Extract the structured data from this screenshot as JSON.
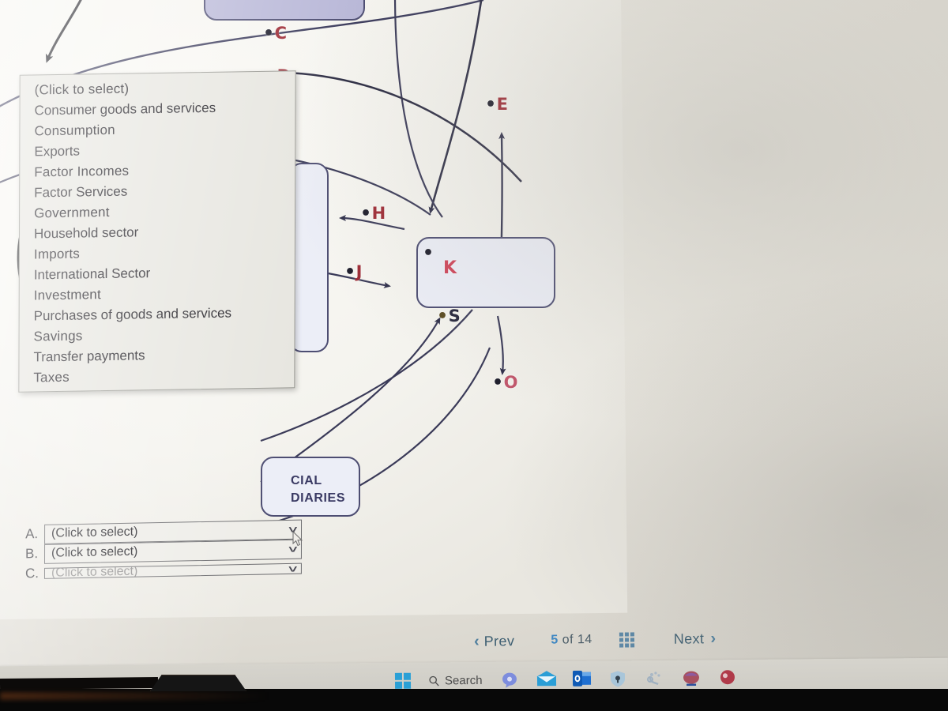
{
  "app": {
    "context": "economics circular-flow diagram worksheet shown on a monitor"
  },
  "dropdown": {
    "name": "open-select-list",
    "options": [
      "(Click to select)",
      "Consumer goods and services",
      "Consumption",
      "Exports",
      "Factor Incomes",
      "Factor Services",
      "Government",
      "Household sector",
      "Imports",
      "International Sector",
      "Investment",
      "Purchases of goods and services",
      "Savings",
      "Transfer payments",
      "Taxes"
    ]
  },
  "answer_rows": [
    {
      "letter": "A.",
      "value": "(Click to select)",
      "chevron": "chevron-down-icon"
    },
    {
      "letter": "B.",
      "value": "(Click to select)",
      "chevron": "chevron-down-icon"
    },
    {
      "letter": "C.",
      "value": "(Click to select)",
      "chevron": "chevron-down-icon"
    }
  ],
  "diagram": {
    "labels": [
      {
        "id": "C",
        "text": "C",
        "dot": "•",
        "color": "#9e2b35"
      },
      {
        "id": "D",
        "text": "D",
        "dot": "•",
        "color": "#9e2b35"
      },
      {
        "id": "E",
        "text": "E",
        "dot": "•",
        "color": "#9e2b35"
      },
      {
        "id": "H",
        "text": "H",
        "dot": "•",
        "color": "#9e2b35"
      },
      {
        "id": "J",
        "text": "J",
        "dot": "•",
        "color": "#9e2b35"
      },
      {
        "id": "K",
        "text": "K",
        "dot": "•",
        "color": "#cf4459"
      },
      {
        "id": "S",
        "text": "S",
        "dot": "•",
        "color": "#26263c"
      },
      {
        "id": "O",
        "text": "O",
        "dot": "•",
        "color": "#c0566b"
      }
    ],
    "boxes": [
      {
        "id": "top-purple-box",
        "label": ""
      },
      {
        "id": "k-box",
        "label": ""
      },
      {
        "id": "left-tall-box",
        "label": ""
      },
      {
        "id": "financial-intermediaries-box",
        "label": "CIAL\nDIARIES",
        "full_label": "FINANCIAL INTERMEDIARIES"
      }
    ]
  },
  "nav": {
    "prev_label": "Prev",
    "prev_icon": "chevron-left-icon",
    "page_current": "5",
    "page_sep": "of",
    "page_total": "14",
    "grid_icon": "grid-menu-icon",
    "next_label": "Next",
    "next_icon": "chevron-right-icon",
    "accent": "#3f87c2"
  },
  "taskbar": {
    "start_icon": "windows-start-icon",
    "search_icon": "search-icon",
    "search_label": "Search",
    "items": [
      {
        "name": "chat-icon",
        "color": "#6c7ede"
      },
      {
        "name": "mail-icon",
        "color": "#2a9ed6"
      },
      {
        "name": "outlook-icon",
        "color": "#1f6fd0"
      },
      {
        "name": "shield-icon",
        "color": "#7aa8cc"
      },
      {
        "name": "settings-icon",
        "color": "#9aaabb"
      },
      {
        "name": "app-icon-1",
        "color": "#a7505f"
      },
      {
        "name": "app-icon-2",
        "color": "#b03b4a"
      }
    ]
  }
}
